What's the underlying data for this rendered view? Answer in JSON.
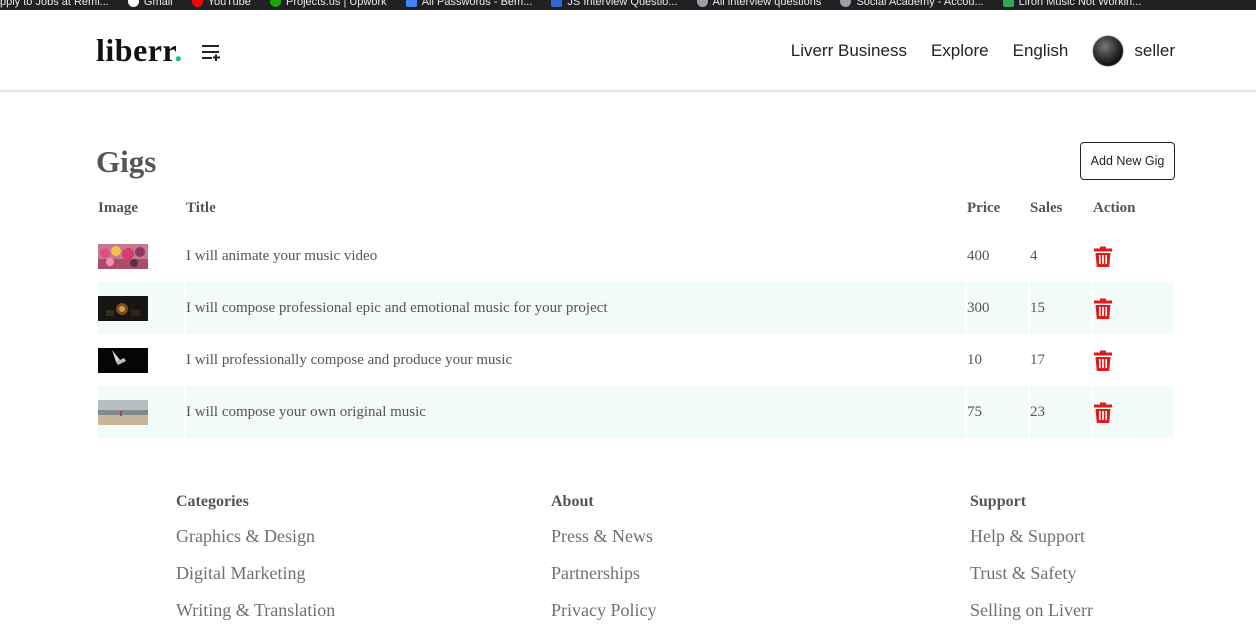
{
  "browser": {
    "bookmarks": [
      {
        "label": "pply to Jobs at Remi...",
        "color": "#202124"
      },
      {
        "label": "Gmail",
        "color": "#ffffff"
      },
      {
        "label": "YouTube",
        "color": "#ff0000"
      },
      {
        "label": "Projects.us | Upwork",
        "color": "#14a800"
      },
      {
        "label": "All Passwords - Bem...",
        "color": "#4285f4"
      },
      {
        "label": "JS Interview Questio...",
        "color": "#3367d6"
      },
      {
        "label": "All interview questions",
        "color": "#9aa0a6"
      },
      {
        "label": "Social Academy - Accou...",
        "color": "#9aa0a6"
      },
      {
        "label": "Liron Music Not Workin...",
        "color": "#34a853"
      }
    ]
  },
  "navbar": {
    "logo_text": "liberr",
    "logo_dot": ".",
    "links": [
      "Liverr Business",
      "Explore",
      "English"
    ],
    "user_name": "seller",
    "brand_color": "#1dbf73"
  },
  "page": {
    "title": "Gigs",
    "add_button": "Add New Gig"
  },
  "table": {
    "headers": [
      "Image",
      "Title",
      "Price",
      "Sales",
      "Action"
    ],
    "rows": [
      {
        "title": "I will animate your music video",
        "price": "400",
        "sales": "4",
        "thumb": "colorful-crowd"
      },
      {
        "title": "I will compose professional epic and emotional music for your project",
        "price": "300",
        "sales": "15",
        "thumb": "dark-orchestra"
      },
      {
        "title": "I will professionally compose and produce your music",
        "price": "10",
        "sales": "17",
        "thumb": "dark-piano"
      },
      {
        "title": "I will compose your own original music",
        "price": "75",
        "sales": "23",
        "thumb": "beach-landscape"
      }
    ],
    "delete_icon": "trash-icon",
    "delete_color": "#e01b1b",
    "alt_row_color": "#f2fbf7"
  },
  "footer": {
    "columns": [
      {
        "heading": "Categories",
        "links": [
          "Graphics & Design",
          "Digital Marketing",
          "Writing & Translation"
        ]
      },
      {
        "heading": "About",
        "links": [
          "Press & News",
          "Partnerships",
          "Privacy Policy"
        ]
      },
      {
        "heading": "Support",
        "links": [
          "Help & Support",
          "Trust & Safety",
          "Selling on Liverr"
        ]
      }
    ]
  }
}
